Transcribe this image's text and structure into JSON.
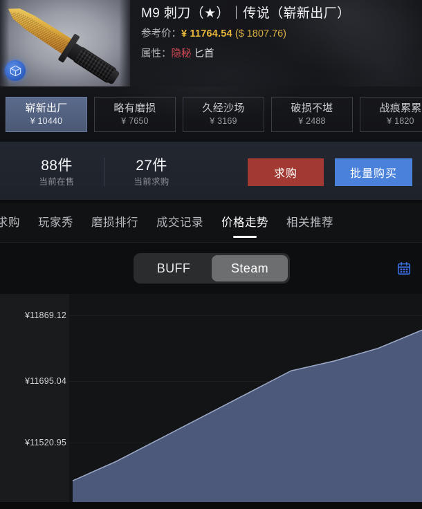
{
  "item": {
    "title": "M9 刺刀（★）｜传说（崭新出厂）",
    "reference_label": "参考价：",
    "reference_price_cny": "¥ 11764.54",
    "reference_price_usd": "($ 1807.76)",
    "attribute_label": "属性：",
    "rarity": "隐秘",
    "category": "匕首",
    "badge_icon": "cube-3d-icon",
    "thumbnail_icon": "m9-bayonet-gold-knife"
  },
  "wear_tabs": [
    {
      "name": "崭新出厂",
      "price": "¥ 10440",
      "active": true
    },
    {
      "name": "略有磨损",
      "price": "¥ 7650",
      "active": false
    },
    {
      "name": "久经沙场",
      "price": "¥ 3169",
      "active": false
    },
    {
      "name": "破损不堪",
      "price": "¥ 2488",
      "active": false
    },
    {
      "name": "战痕累累",
      "price": "¥ 1820",
      "active": false
    }
  ],
  "stats": [
    {
      "value": "88件",
      "label": "当前在售"
    },
    {
      "value": "27件",
      "label": "当前求购"
    }
  ],
  "actions": {
    "bid_label": "求购",
    "buy_label": "批量购买",
    "bid_color": "#a23a33",
    "buy_color": "#4a81da"
  },
  "nav_tabs": [
    {
      "label": "求购",
      "active": false
    },
    {
      "label": "玩家秀",
      "active": false
    },
    {
      "label": "磨损排行",
      "active": false
    },
    {
      "label": "成交记录",
      "active": false
    },
    {
      "label": "价格走势",
      "active": true
    },
    {
      "label": "相关推荐",
      "active": false
    }
  ],
  "chart_toolbar": {
    "sources": [
      {
        "label": "BUFF",
        "active": false
      },
      {
        "label": "Steam",
        "active": true
      }
    ],
    "calendar_icon": "calendar-icon",
    "calendar_color": "#3c6fe0"
  },
  "chart_data": {
    "type": "area",
    "title": "价格走势",
    "source": "Steam",
    "xlabel": "",
    "ylabel": "",
    "grid": true,
    "legend": "none",
    "ytick_labels": [
      "¥11869.12",
      "¥11695.04",
      "¥11520.95"
    ],
    "ytick_values": [
      11869.12,
      11695.04,
      11520.95
    ],
    "ylim": [
      11450.0,
      11910.0
    ],
    "line_color": "#9aa7c4",
    "fill_color": "#4e5b7d",
    "x": [
      0,
      1,
      2,
      3,
      4,
      5,
      6,
      7,
      8
    ],
    "values": [
      11497.0,
      11540.0,
      11590.0,
      11640.0,
      11690.0,
      11740.0,
      11762.0,
      11790.0,
      11830.0
    ]
  }
}
